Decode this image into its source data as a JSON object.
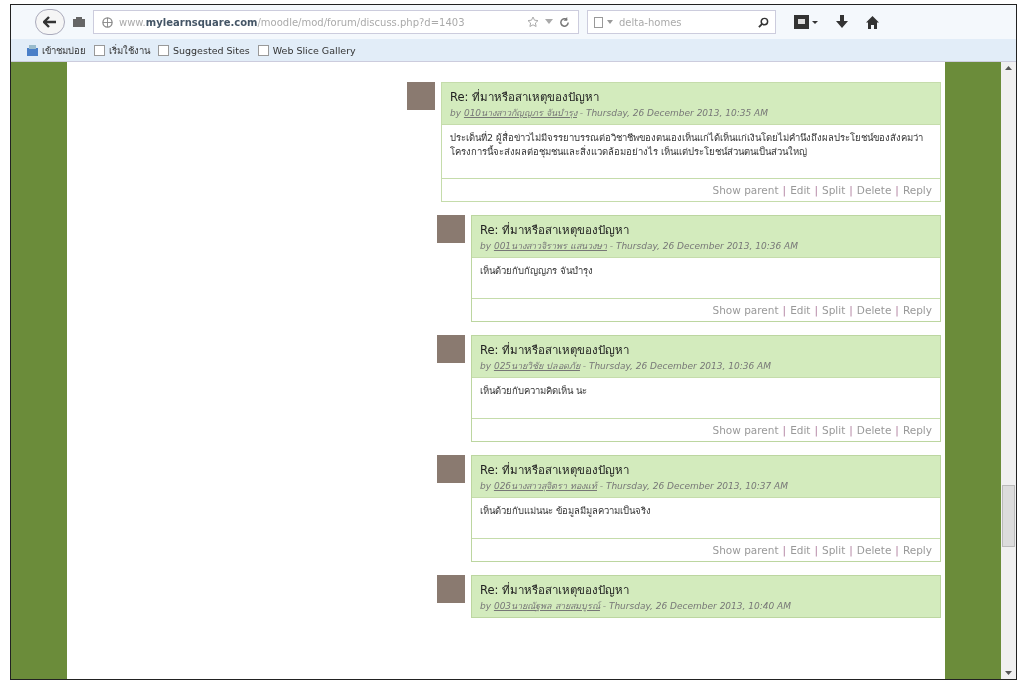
{
  "browser": {
    "url": {
      "prefix": "www.",
      "domain": "mylearnsquare.com",
      "path": "/moodle/mod/forum/discuss.php?d=1403"
    },
    "search": {
      "placeholder": "delta-homes"
    },
    "bookmarks": [
      "เข้าชมบ่อย",
      "เริ่มใช้งาน",
      "Suggested Sites",
      "Web Slice Gallery"
    ]
  },
  "posts": [
    {
      "nested": false,
      "subject": "Re: ที่มาหรือสาเหตุของปัญหา",
      "by": "by",
      "author": "010นางสาวกัญญภร จันบำรุง",
      "date": "- Thursday, 26 December 2013, 10:35 AM",
      "body": "ประเด็นที่2 ผู้สื่อข่าวไม่มีจรรยาบรรณต่อวิชาชีพของตนเองเห็นแก่ได้เห็นแก่เงินโดยไม่คำนึงถึงผลประโยชน์ของสังคมว่าโครงการนี้จะส่งผลต่อชุมชนและสิ่งแวดล้อมอย่างไร  เห็นแต่ประโยชน์ส่วนตนเป็นส่วนใหญ่",
      "links": [
        "Show parent",
        "Edit",
        "Split",
        "Delete",
        "Reply"
      ],
      "separator": "|"
    },
    {
      "nested": true,
      "subject": "Re: ที่มาหรือสาเหตุของปัญหา",
      "by": "by",
      "author": "001นางสาวจิราพร แสนวงษา",
      "date": "- Thursday, 26 December 2013, 10:36 AM",
      "body": "เห็นด้วยกับกัญญภร จันบำรุง",
      "links": [
        "Show parent",
        "Edit",
        "Split",
        "Delete",
        "Reply"
      ],
      "separator": "|"
    },
    {
      "nested": true,
      "subject": "Re: ที่มาหรือสาเหตุของปัญหา",
      "by": "by",
      "author": "025นายวิชัย ปลอดภัย",
      "date": "- Thursday, 26 December 2013, 10:36 AM",
      "body": "เห็นด้วยกับความคิดเห็น นะ",
      "links": [
        "Show parent",
        "Edit",
        "Split",
        "Delete",
        "Reply"
      ],
      "separator": "|"
    },
    {
      "nested": true,
      "subject": "Re: ที่มาหรือสาเหตุของปัญหา",
      "by": "by",
      "author": "026นางสาวสุจิตรา ทองแท้",
      "date": "- Thursday, 26 December 2013, 10:37 AM",
      "body": "เห็นด้วยกับแม่นนะ ข้อมูลมีมูลความเป็นจริง",
      "links": [
        "Show parent",
        "Edit",
        "Split",
        "Delete",
        "Reply"
      ],
      "separator": "|"
    },
    {
      "nested": true,
      "subject": "Re: ที่มาหรือสาเหตุของปัญหา",
      "by": "by",
      "author": "003นายณัฐพล สายสมบูรณ์",
      "date": "- Thursday, 26 December 2013, 10:40 AM"
    }
  ]
}
